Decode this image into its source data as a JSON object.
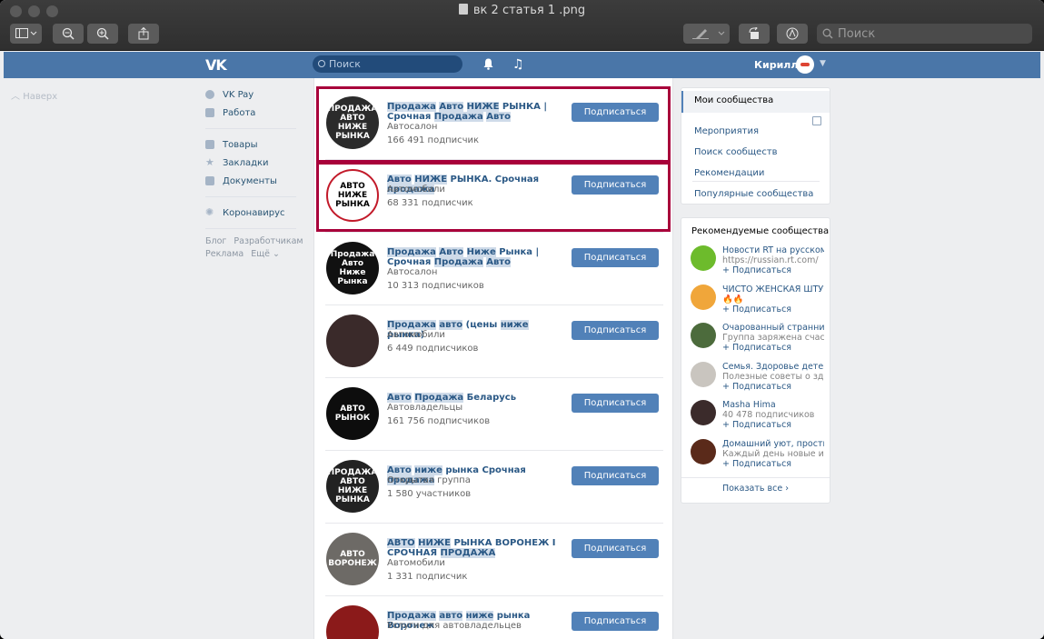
{
  "window": {
    "title": "вк 2 статья 1 .png",
    "search_placeholder": "Поиск"
  },
  "vk": {
    "logo": "VK",
    "search_placeholder": "Поиск",
    "user_name": "Кирилл"
  },
  "left": {
    "back_label": "Наверх",
    "items": [
      {
        "label": "VK Pay"
      },
      {
        "label": "Работа"
      },
      {
        "label": "Товары"
      },
      {
        "label": "Закладки"
      },
      {
        "label": "Документы"
      },
      {
        "label": "Коронавирус"
      }
    ],
    "footer": [
      "Блог",
      "Разработчикам",
      "Реклама",
      "Ещё ⌄"
    ]
  },
  "button_label": "Подписаться",
  "groups": [
    {
      "name_parts": [
        [
          "Продажа",
          1
        ],
        [
          " ",
          0
        ],
        [
          "Авто",
          1
        ],
        [
          " ",
          0
        ],
        [
          "НИЖЕ",
          1
        ],
        [
          " РЫНКА | Срочная ",
          0
        ],
        [
          "Продажа",
          1
        ],
        [
          " ",
          0
        ],
        [
          "Авто",
          1
        ]
      ],
      "category": "Автосалон",
      "members": "166 491 подписчик",
      "avatar_text": "ПРОДАЖА АВТО НИЖЕ РЫНКА",
      "avatar_color": "#2b2b2b"
    },
    {
      "name_parts": [
        [
          "Авто",
          1
        ],
        [
          " ",
          0
        ],
        [
          "НИЖЕ",
          1
        ],
        [
          " РЫНКА. Срочная ",
          0
        ],
        [
          "продажа",
          1
        ]
      ],
      "category": "Автомобили",
      "members": "68 331 подписчик",
      "avatar_text": "АВТО НИЖЕ РЫНКА",
      "avatar_color": "#ffffff"
    },
    {
      "name_parts": [
        [
          "Продажа",
          1
        ],
        [
          " ",
          0
        ],
        [
          "Авто",
          1
        ],
        [
          " ",
          0
        ],
        [
          "Ниже",
          1
        ],
        [
          " Рынка | Срочная ",
          0
        ],
        [
          "Продажа",
          1
        ],
        [
          " ",
          0
        ],
        [
          "Авто",
          1
        ]
      ],
      "category": "Автосалон",
      "members": "10 313 подписчиков",
      "avatar_text": "Продажа Авто Ниже Рынка",
      "avatar_color": "#111111"
    },
    {
      "name_parts": [
        [
          "Продажа",
          1
        ],
        [
          " ",
          0
        ],
        [
          "авто",
          1
        ],
        [
          " (цены ",
          0
        ],
        [
          "ниже",
          1
        ],
        [
          " рынка)",
          0
        ]
      ],
      "category": "Автомобили",
      "members": "6 449 подписчиков",
      "avatar_text": "",
      "avatar_color": "#3a2a2a"
    },
    {
      "name_parts": [
        [
          "Авто",
          1
        ],
        [
          " ",
          0
        ],
        [
          "Продажа",
          1
        ],
        [
          " Беларусь",
          0
        ]
      ],
      "category": "Автовладельцы",
      "members": "161 756 подписчиков",
      "avatar_text": "АВТО РЫНОК",
      "avatar_color": "#0d0d0d"
    },
    {
      "name_parts": [
        [
          "Авто",
          1
        ],
        [
          " ",
          0
        ],
        [
          "ниже",
          1
        ],
        [
          " рынка Срочная ",
          0
        ],
        [
          "продажа",
          1
        ]
      ],
      "category": "Открытая группа",
      "members": "1 580 участников",
      "avatar_text": "ПРОДАЖА АВТО НИЖЕ РЫНКА",
      "avatar_color": "#222222"
    },
    {
      "name_parts": [
        [
          "АВТО",
          1
        ],
        [
          " ",
          0
        ],
        [
          "НИЖЕ",
          1
        ],
        [
          " РЫНКА ВОРОНЕЖ I СРОЧНАЯ ",
          0
        ],
        [
          "ПРОДАЖА",
          1
        ]
      ],
      "category": "Автомобили",
      "members": "1 331 подписчик",
      "avatar_text": "АВТО ВОРОНЕЖ",
      "avatar_color": "#6d6a66"
    },
    {
      "name_parts": [
        [
          "Продажа",
          1
        ],
        [
          " ",
          0
        ],
        [
          "авто",
          1
        ],
        [
          " ",
          0
        ],
        [
          "ниже",
          1
        ],
        [
          " рынка Воронеж",
          0
        ]
      ],
      "category": "Услуги для автовладельцев",
      "members": "",
      "avatar_text": "",
      "avatar_color": "#8b1a1a"
    }
  ],
  "right_nav": {
    "active": "Мои сообщества",
    "items": [
      "Мероприятия",
      "Поиск сообществ",
      "Рекомендации",
      "Популярные сообщества"
    ]
  },
  "recommended": {
    "title": "Рекомендуемые сообщества",
    "add_label": "+ Подписаться",
    "show_all": "Показать все",
    "items": [
      {
        "title": "Новости RT на русском",
        "desc": "https://russian.rt.com/",
        "color": "#6dbb2c"
      },
      {
        "title": "ЧИСТО ЖЕНСКАЯ ШТУЧКА",
        "desc": "🔥🔥",
        "color": "#f0a63a"
      },
      {
        "title": "Очарованный странник",
        "desc": "Группа заряжена счастьем",
        "color": "#4c6b3c"
      },
      {
        "title": "Семья. Здоровье детей",
        "desc": "Полезные советы о здоровье",
        "color": "#c9c5bf"
      },
      {
        "title": "Masha Hima",
        "desc": "40 478 подписчиков",
        "color": "#3b2b2b"
      },
      {
        "title": "Домашний уют, простые",
        "desc": "Каждый день новые идеи",
        "color": "#5a2a1a"
      }
    ]
  }
}
